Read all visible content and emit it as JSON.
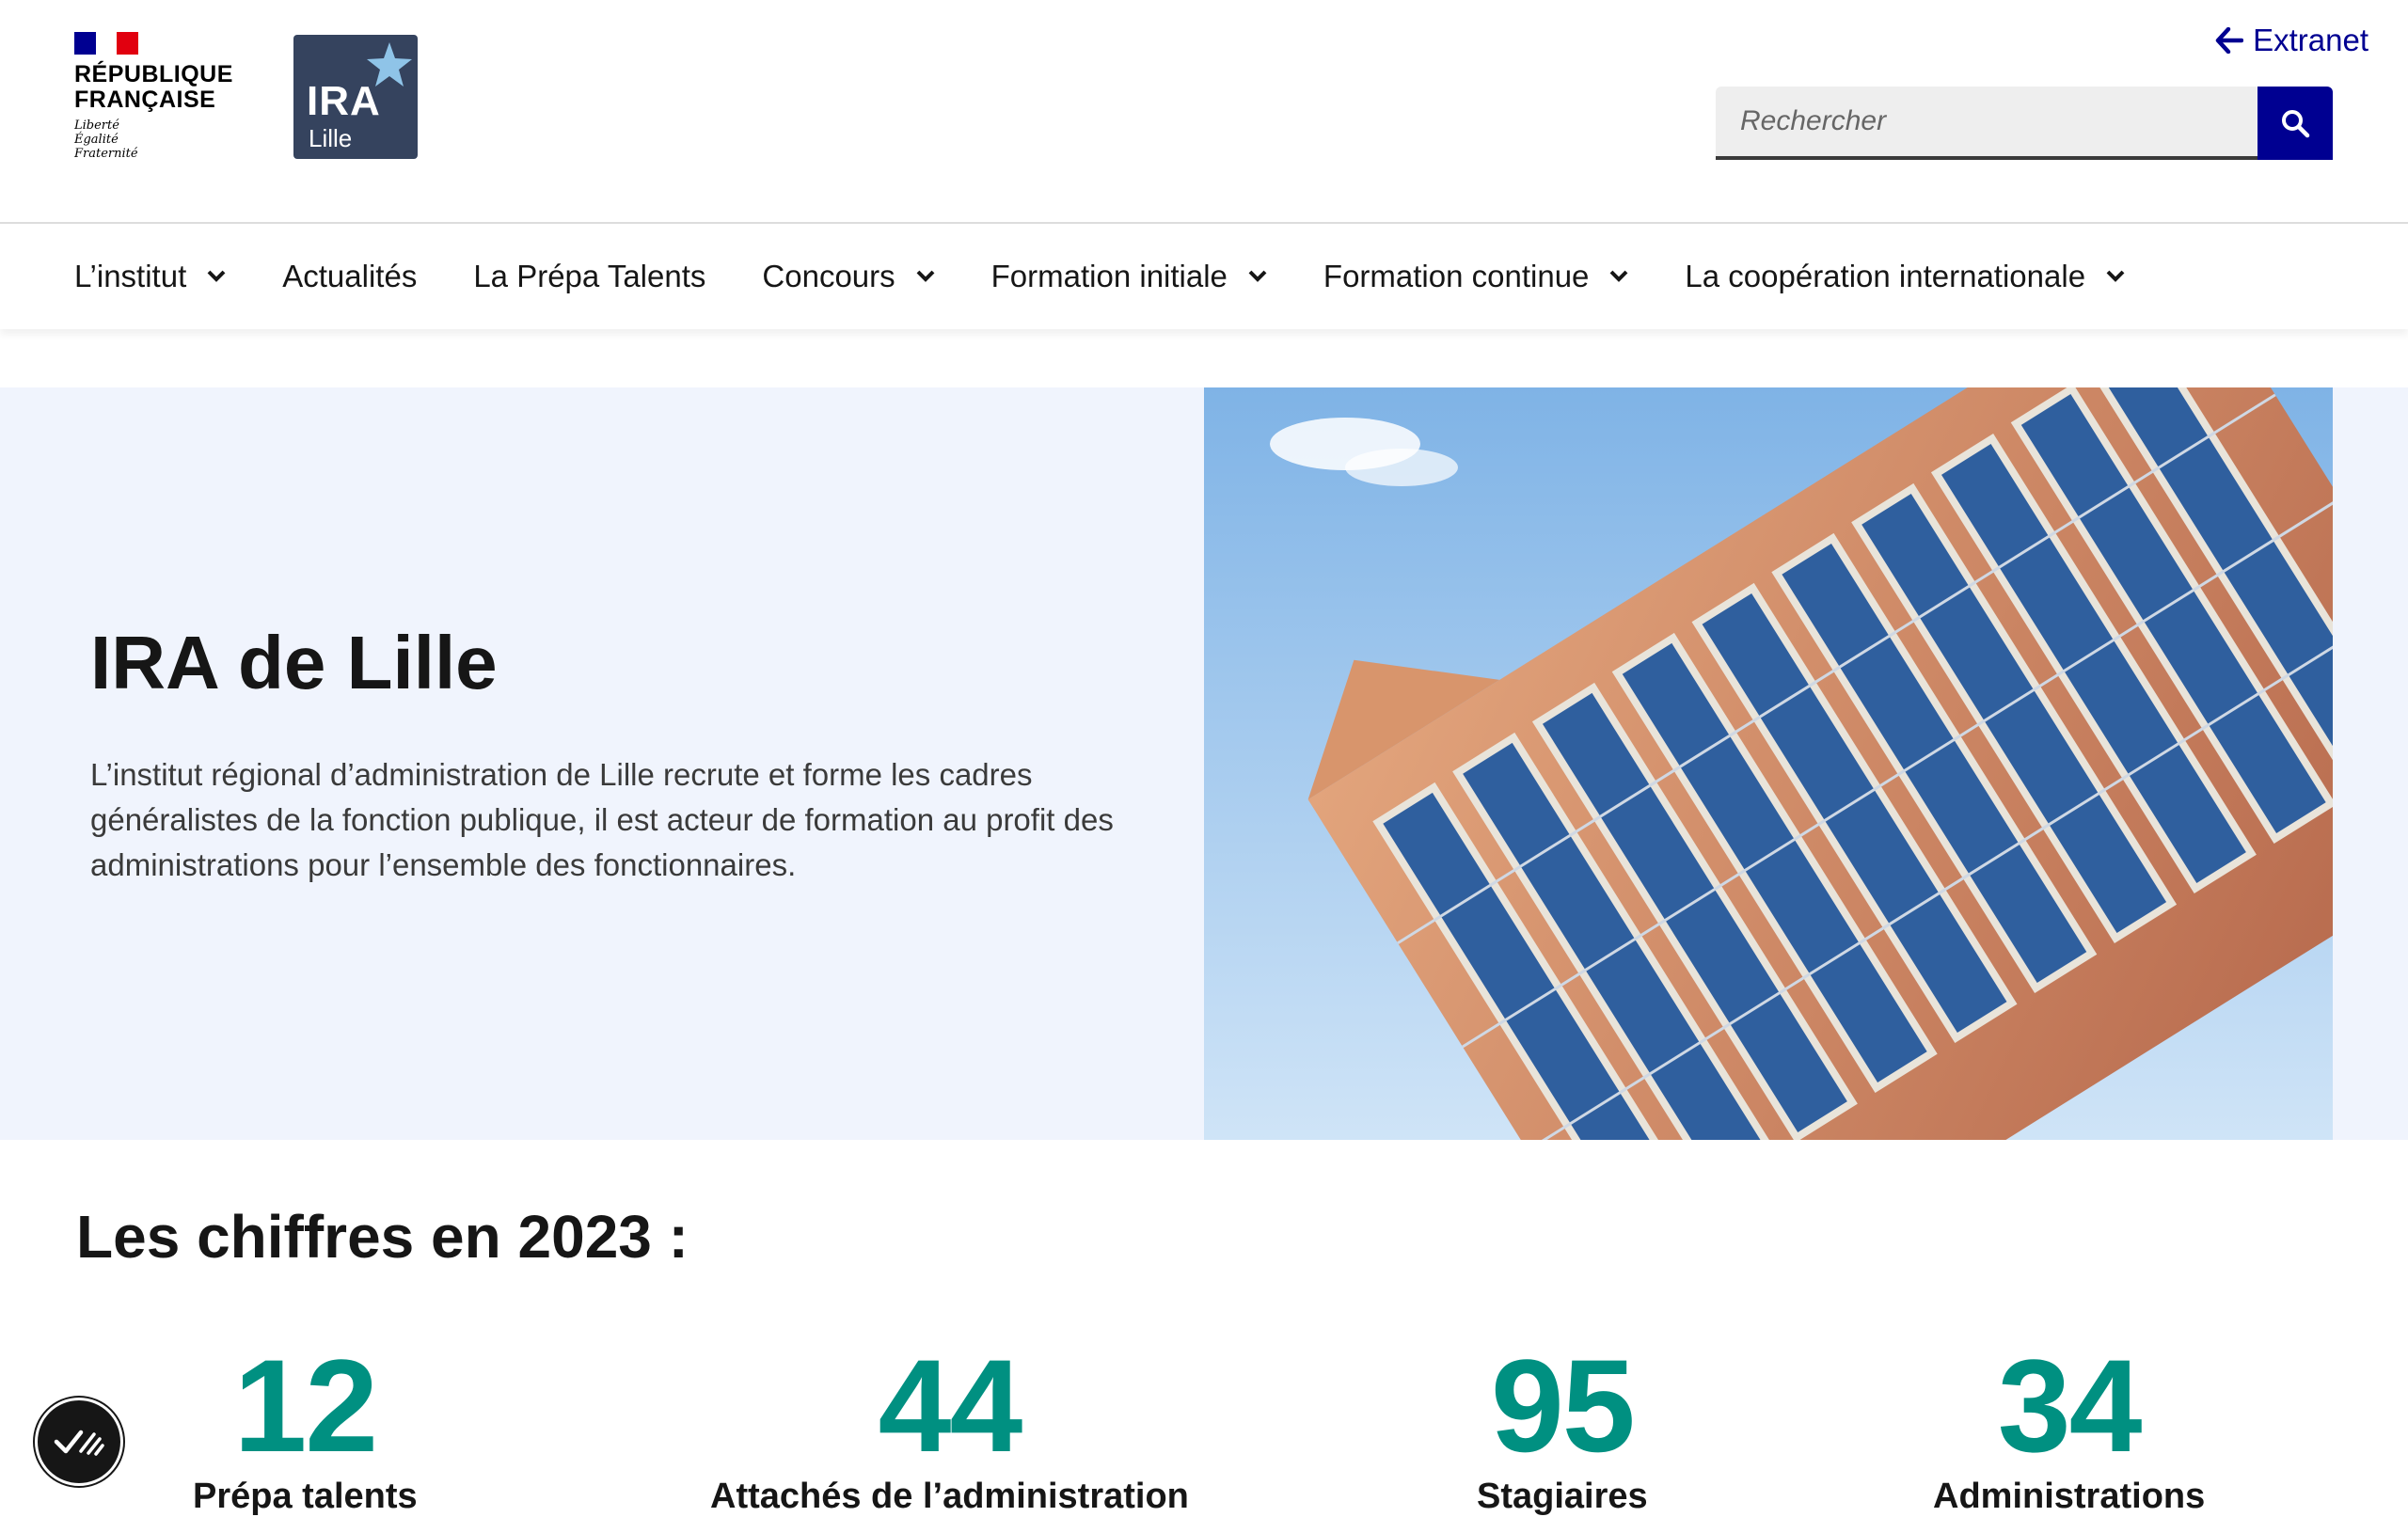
{
  "header": {
    "marianne": {
      "flag_colors": [
        "#000091",
        "#ffffff",
        "#e1000f"
      ],
      "title_line1": "RÉPUBLIQUE",
      "title_line2": "FRANÇAISE",
      "motto_line1": "Liberté",
      "motto_line2": "Égalité",
      "motto_line3": "Fraternité"
    },
    "ira_logo": {
      "big": "IRA",
      "small": "Lille",
      "star_icon": "star-icon"
    },
    "extranet": {
      "label": "Extranet",
      "icon": "arrow-left-icon"
    },
    "search": {
      "placeholder": "Rechercher",
      "icon": "search-icon"
    }
  },
  "nav": {
    "items": [
      {
        "label": "L’institut",
        "dropdown": true
      },
      {
        "label": "Actualités",
        "dropdown": false
      },
      {
        "label": "La Prépa Talents",
        "dropdown": false
      },
      {
        "label": "Concours",
        "dropdown": true
      },
      {
        "label": "Formation initiale",
        "dropdown": true
      },
      {
        "label": "Formation continue",
        "dropdown": true
      },
      {
        "label": "La coopération internationale",
        "dropdown": true
      }
    ]
  },
  "hero": {
    "title": "IRA de Lille",
    "description": "L’institut régional d’administration de Lille recrute et forme les cadres généralistes de la fonction publique, il est acteur de formation au profit des administrations pour l’ensemble des fonctionnaires."
  },
  "stats": {
    "title": "Les chiffres en 2023 :",
    "items": [
      {
        "value": "12",
        "label": "Prépa talents"
      },
      {
        "value": "44",
        "label": "Attachés de l’administration"
      },
      {
        "value": "95",
        "label": "Stagiaires"
      },
      {
        "value": "34",
        "label": "Administrations"
      }
    ]
  },
  "colors": {
    "primary_blue": "#000091",
    "accent_green": "#009081",
    "hero_bg": "#f0f4fd"
  },
  "accessibility_button": {
    "icon": "accessibility-check-icon"
  }
}
